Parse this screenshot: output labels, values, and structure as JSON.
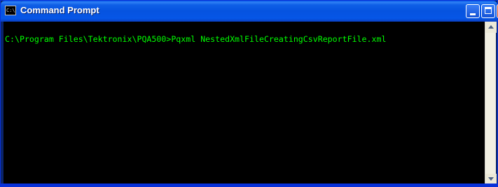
{
  "window": {
    "title": "Command Prompt",
    "icon": "cmd-icon",
    "icon_glyph": "C:\\",
    "controls": {
      "minimize": "minimize-icon",
      "maximize": "maximize-icon",
      "close": "close-icon",
      "close_glyph": "×"
    }
  },
  "console": {
    "line": "C:\\Program Files\\Tektronix\\PQA500>Pqxml NestedXmlFileCreatingCsvReportFile.xml",
    "text_color": "#00ff00",
    "background": "#000000"
  },
  "scrollbar": {
    "up": "scroll-up-icon",
    "down": "scroll-down-icon"
  }
}
